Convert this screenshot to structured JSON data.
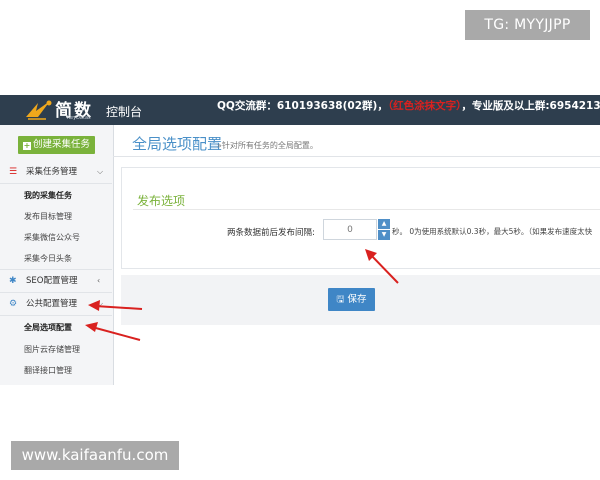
{
  "watermarks": {
    "telegram": "TG: MYYJJPP",
    "site": "www.kaifaanfu.com"
  },
  "header": {
    "logo_text": "简数",
    "logo_sub": "KeyDatas",
    "console": "控制台",
    "qq_prefix": "QQ交流群：610193638(02群)，",
    "qq_red": "（红色涂抹文字）",
    "qq_suffix": "，专业版及以上群:695421375"
  },
  "sidebar": {
    "create_button": "创建采集任务",
    "sections": [
      {
        "label": "采集任务管理",
        "icon": "list-icon"
      },
      {
        "label": "SEO配置管理",
        "icon": "gear-icon"
      },
      {
        "label": "公共配置管理",
        "icon": "gears-icon"
      }
    ],
    "collect_items": [
      "我的采集任务",
      "发布目标管理",
      "采集微信公众号",
      "采集今日头条"
    ],
    "public_items": [
      "全局选项配置",
      "图片云存储管理",
      "翻译接口管理"
    ]
  },
  "main": {
    "title": "全局选项配置",
    "subtitle": "»针对所有任务的全局配置。",
    "panel_title": "发布选项",
    "field_label": "两条数据前后发布间隔:",
    "field_value": "0",
    "field_hint": "秒。 0为使用系统默认0.3秒，最大5秒。（如果发布速度太快",
    "save_label": "保存"
  },
  "colors": {
    "topbar": "#2e3e4e",
    "accent_green": "#7ab23b",
    "accent_blue": "#3f86c6",
    "title_blue": "#4a90c8",
    "arrow_red": "#d9211f"
  }
}
